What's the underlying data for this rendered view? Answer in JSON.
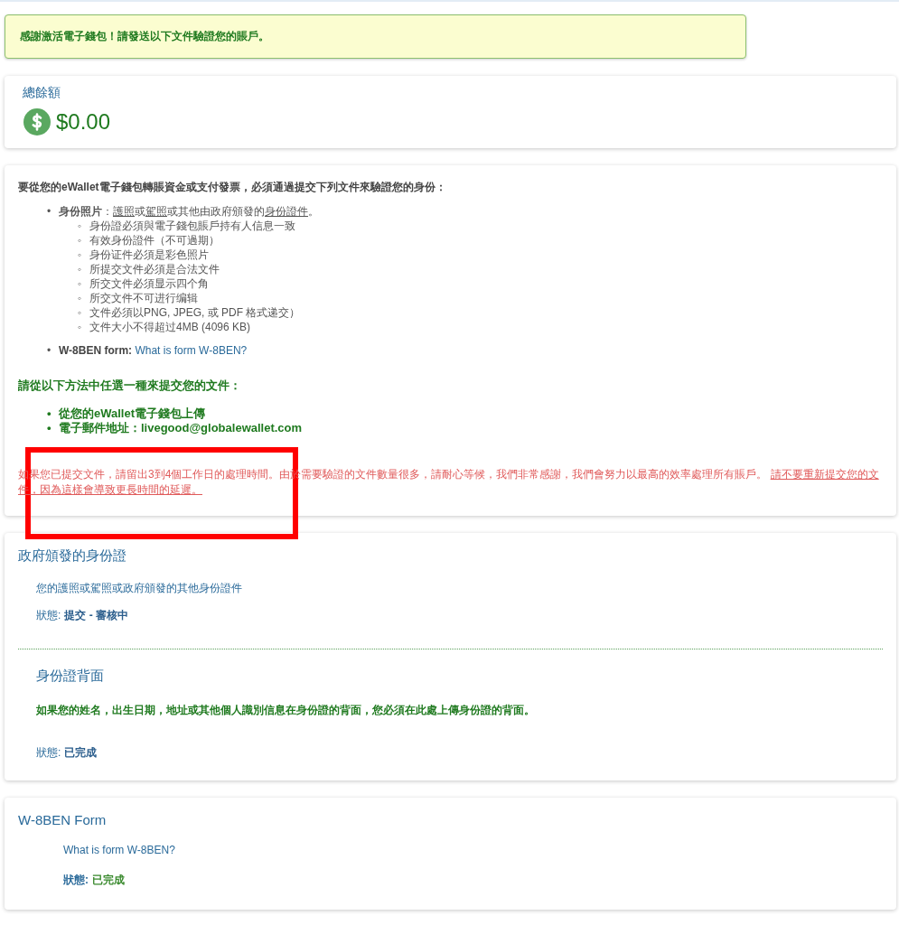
{
  "alert": {
    "message": "感謝激活電子錢包！請發送以下文件驗證您的賬戶。"
  },
  "balance": {
    "label": "總餘額",
    "amount": "$0.00"
  },
  "requirements": {
    "intro": "要從您的eWallet電子錢包轉賬資金或支付發票，必須通過提交下列文件來驗證您的身份：",
    "id_photo": {
      "marker": "•",
      "segments": [
        {
          "text": "**身份照片**：",
          "kind": "plain"
        },
        {
          "text": "護照",
          "kind": "underline"
        },
        {
          "text": "或",
          "kind": "plain"
        },
        {
          "text": "駕照",
          "kind": "underline"
        },
        {
          "text": "或其他由政府頒發的",
          "kind": "plain"
        },
        {
          "text": "身份證件",
          "kind": "underline"
        },
        {
          "text": "。",
          "kind": "plain"
        }
      ],
      "rules": [
        {
          "marker": "◦",
          "text": "身份證必須與電子錢包賬戶持有人信息一致"
        },
        {
          "marker": "◦",
          "text": "有效身份證件（不可過期）"
        },
        {
          "marker": "◦",
          "text": "身份证件必須是彩色照片"
        },
        {
          "marker": "◦",
          "text": "所提交文件必須是合法文件"
        },
        {
          "marker": "◦",
          "text": "所交文件必須显示四个角"
        },
        {
          "marker": "◦",
          "text": "所交文件不可进行编辑"
        },
        {
          "marker": "◦",
          "text": "文件必須以PNG, JPEG, 或 PDF 格式递交）"
        },
        {
          "marker": "◦",
          "text": "文件大小不得超过4MB (4096 KB)"
        }
      ]
    },
    "w8ben": {
      "marker": "•",
      "label": "W-8BEN form:",
      "link": "What is form W-8BEN?"
    },
    "methods_title": "請從以下方法中任選一種來提交您的文件：",
    "methods": [
      {
        "marker": "•",
        "text": "從您的eWallet電子錢包上傳"
      },
      {
        "marker": "•",
        "text": "電子郵件地址：livegood@globalewallet.com"
      }
    ],
    "notice": {
      "text": "如果您已提交文件，請留出3到4個工作日的處理時間。由於需要驗證的文件數量很多，請耐心等候，我們非常感謝，我們會努力以最高的效率處理所有賬戶。 ",
      "emphasis": "請不要重新提交您的文件，因為這樣會導致更長時間的延遲。"
    }
  },
  "gov_id": {
    "title": "政府頒發的身份證",
    "description": "您的護照或駕照或政府頒發的其他身份證件",
    "status": {
      "label": "狀態:",
      "value": "提交 - 審核中",
      "color": "#2a5d8c"
    },
    "back": {
      "title": "身份證背面",
      "description": "如果您的姓名，出生日期，地址或其他個人識別信息在身份證的背面，您必須在此處上傳身份證的背面。",
      "status": {
        "label": "狀態:",
        "value": "已完成",
        "color": "#2a5d8c"
      }
    }
  },
  "w8ben_form": {
    "title": "W-8BEN Form",
    "link": "What is form W-8BEN?",
    "status": {
      "label": "狀態:",
      "value": "已完成",
      "color": "#3a8a2e"
    }
  }
}
